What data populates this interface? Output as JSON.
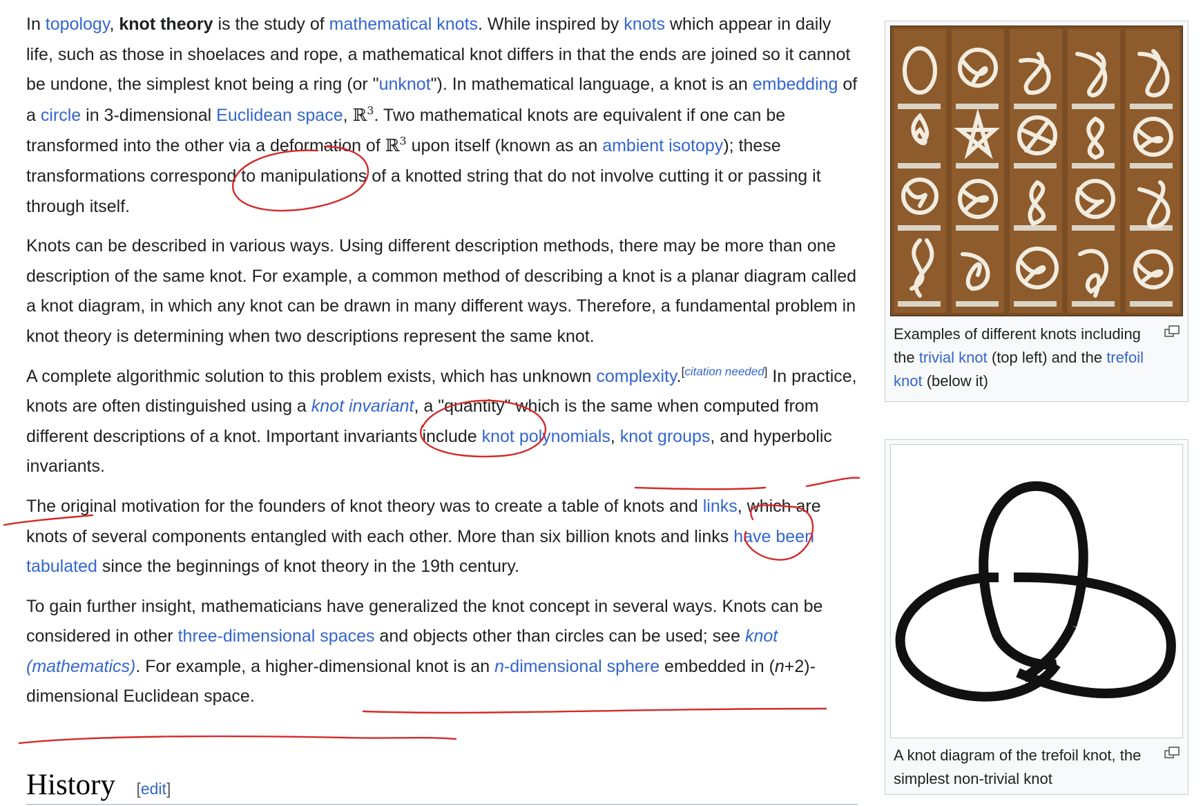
{
  "article": {
    "p1": {
      "s1": "In ",
      "l_topology": "topology",
      "s2": ", ",
      "b_knot_theory": "knot theory",
      "s3": " is the study of ",
      "l_mathematical_knots": "mathematical knots",
      "s4": ". While inspired by ",
      "l_knots": "knots",
      "s5": " which appear in daily life, such as those in shoelaces and rope, a mathematical knot differs in that the ends are joined so it cannot be undone, the simplest knot being a ring (or \"",
      "l_unknot": "unknot",
      "s6": "\"). In mathematical language, a knot is an ",
      "l_embedding": "embedding",
      "s7": " of a ",
      "l_circle": "circle",
      "s8": " in 3-dimensional ",
      "l_euclidean_space": "Euclidean space",
      "s9": ", ",
      "r3_a": "ℝ",
      "r3_a_sup": "3",
      "s10": ". Two mathematical knots are equivalent if one can be transformed into the other via a deformation of ",
      "r3_b": "ℝ",
      "r3_b_sup": "3",
      "s11": " upon itself (known as an ",
      "l_ambient_isotopy": "ambient isotopy",
      "s12": "); these transformations correspond to manipulations of a knotted string that do not involve cutting it or passing it through itself."
    },
    "p2": "Knots can be described in various ways. Using different description methods, there may be more than one description of the same knot. For example, a common method of describing a knot is a planar diagram called a knot diagram, in which any knot can be drawn in many different ways. Therefore, a fundamental problem in knot theory is determining when two descriptions represent the same knot.",
    "p3": {
      "s1": "A complete algorithmic solution to this problem exists, which has unknown ",
      "l_complexity": "complexity",
      "s2": ".",
      "cite_open": "[",
      "cite_text": "citation needed",
      "cite_close": "]",
      "s3": " In practice, knots are often distinguished using a ",
      "l_knot_invariant": "knot invariant",
      "s4": ", a \"quantity\" which is the same when computed from different descriptions of a knot. Important invariants include ",
      "l_knot_polynomials": "knot polynomials",
      "s5": ", ",
      "l_knot_groups": "knot groups",
      "s6": ", and hyperbolic invariants."
    },
    "p4": {
      "s1": "The original motivation for the founders of knot theory was to create a table of knots and ",
      "l_links": "links",
      "s2": ", which are knots of several components entangled with each other. More than six billion knots and links ",
      "l_tabulated": "have been tabulated",
      "s3": " since the beginnings of knot theory in the 19th century."
    },
    "p5": {
      "s1": "To gain further insight, mathematicians have generalized the knot concept in several ways. Knots can be considered in other ",
      "l_three_dim_spaces": "three-dimensional spaces",
      "s2": " and objects other than circles can be used; see ",
      "l_knot_math": "knot (mathematics)",
      "s3": ". For example, a higher-dimensional knot is an ",
      "l_n_sphere_n": "n",
      "l_n_sphere_rest": "-dimensional sphere",
      "s4": " embedded in (",
      "i_n": "n",
      "s5": "+2)-dimensional Euclidean space."
    },
    "history": {
      "title": "History",
      "edit_open": "[",
      "edit_label": "edit",
      "edit_close": "]"
    }
  },
  "figures": {
    "knot_board": {
      "caption_s1": "Examples of different knots including the ",
      "l_trivial_knot": "trivial knot",
      "caption_s2": " (top left) and the ",
      "l_trefoil_knot": "trefoil knot",
      "caption_s3": " (below it)"
    },
    "trefoil": {
      "caption": "A knot diagram of the trefoil knot, the simplest non-trivial knot"
    }
  },
  "colors": {
    "link": "#3366cc",
    "text": "#202122",
    "annotation_ink": "#d42a2a",
    "board_wood": "#7a4d24",
    "rope": "#f2ece0"
  },
  "icons": [
    "magnify-clip-icon"
  ]
}
